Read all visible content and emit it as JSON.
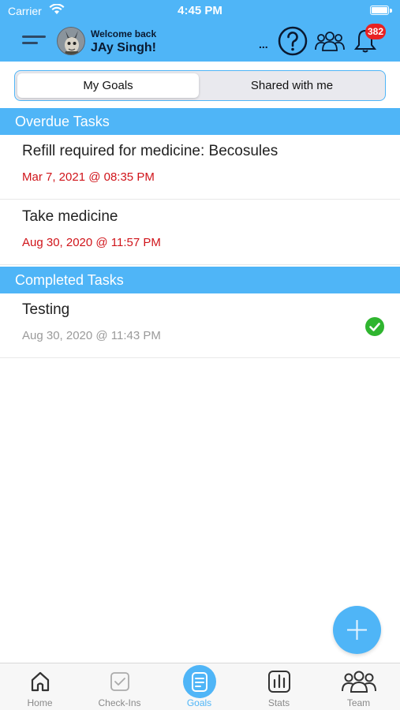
{
  "status_bar": {
    "carrier": "Carrier",
    "time": "4:45 PM"
  },
  "header": {
    "welcome": "Welcome back",
    "user_name": "JAy Singh!",
    "more": "...",
    "notification_count": "382",
    "icons": [
      "menu-icon",
      "avatar",
      "help-icon",
      "team-icon",
      "bell-icon"
    ]
  },
  "segment": {
    "tabs": [
      {
        "label": "My Goals",
        "active": true
      },
      {
        "label": "Shared with me",
        "active": false
      }
    ]
  },
  "sections": {
    "overdue": {
      "title": "Overdue Tasks",
      "tasks": [
        {
          "title": "Refill required for medicine: Becosules",
          "date": "Mar 7, 2021 @ 08:35 PM"
        },
        {
          "title": "Take medicine",
          "date": "Aug 30, 2020 @ 11:57 PM"
        }
      ]
    },
    "completed": {
      "title": "Completed Tasks",
      "tasks": [
        {
          "title": "Testing",
          "date": "Aug 30, 2020 @ 11:43 PM",
          "completed": true
        }
      ]
    }
  },
  "tabbar": {
    "items": [
      {
        "label": "Home",
        "icon": "home-icon"
      },
      {
        "label": "Check-Ins",
        "icon": "checkin-icon"
      },
      {
        "label": "Goals",
        "icon": "goals-icon",
        "active": true
      },
      {
        "label": "Stats",
        "icon": "stats-icon"
      },
      {
        "label": "Team",
        "icon": "team-icon"
      }
    ]
  },
  "colors": {
    "accent": "#4fb5f7",
    "overdue": "#d0141a",
    "complete": "#2fb52f",
    "badge": "#e82222"
  }
}
